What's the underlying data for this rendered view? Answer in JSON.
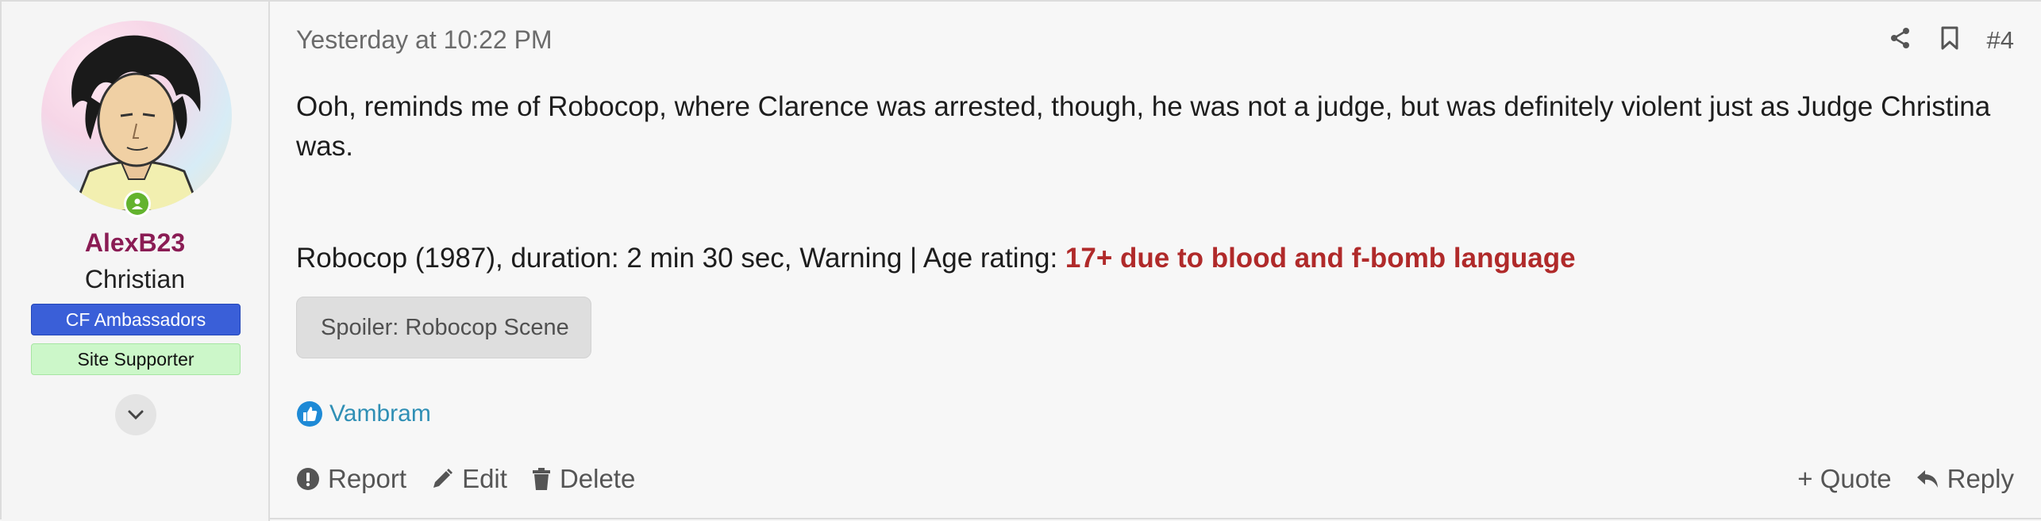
{
  "user": {
    "name": "AlexB23",
    "title": "Christian",
    "banners": [
      "CF Ambassadors",
      "Site Supporter"
    ],
    "online": true
  },
  "post": {
    "timestamp": "Yesterday at 10:22 PM",
    "number": "#4",
    "message": "Ooh, reminds me of Robocop, where Clarence was arrested, though, he was not a judge, but was definitely violent just as Judge Christina was.",
    "info_prefix": "Robocop (1987), duration: 2 min 30 sec, Warning | Age rating: ",
    "info_warning": "17+ due to blood and f-bomb language",
    "spoiler_label": "Spoiler: Robocop Scene",
    "reactor": "Vambram"
  },
  "actions": {
    "report": "Report",
    "edit": "Edit",
    "delete": "Delete",
    "quote": "+ Quote",
    "reply": "Reply"
  },
  "colors": {
    "username": "#8a1c54",
    "warning": "#b02a2a",
    "ambassador_banner": "#3a5fd8",
    "supporter_banner": "#ccf7c9",
    "reaction_link": "#2f8fb5",
    "online": "#63b32e"
  },
  "icons": [
    "share-icon",
    "bookmark-icon",
    "chevron-down-icon",
    "like-icon",
    "report-icon",
    "edit-icon",
    "delete-icon",
    "reply-icon"
  ]
}
